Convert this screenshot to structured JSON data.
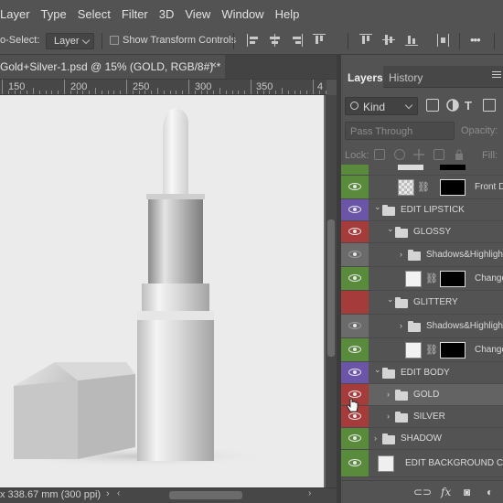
{
  "menubar": {
    "items": [
      "Layer",
      "Type",
      "Select",
      "Filter",
      "3D",
      "View",
      "Window",
      "Help"
    ]
  },
  "options_bar": {
    "auto_select_label": "o-Select:",
    "auto_select_value": "Layer",
    "show_transform_label": "Show Transform Controls",
    "show_transform_checked": false,
    "more_label": "•••"
  },
  "document": {
    "tab_title": "Gold+Silver-1.psd @ 15% (GOLD, RGB/8#) *",
    "close_glyph": "×",
    "ruler_labels": [
      "150",
      "200",
      "250",
      "300",
      "350",
      "4"
    ],
    "status_text": "x 338.67 mm (300 ppi)",
    "status_arrow": "›",
    "scroll_left": "‹",
    "scroll_right": "›"
  },
  "panel": {
    "tabs": [
      "Layers",
      "History"
    ],
    "kind_value": "Kind",
    "blend_mode": "Pass Through",
    "opacity_label": "Opacity:",
    "lock_label": "Lock:",
    "fill_label": "Fill:",
    "layers": [
      {
        "name": "",
        "type": "partial",
        "vis": "green"
      },
      {
        "name": "Front D",
        "type": "layer-mask-dark",
        "vis": "green",
        "indent": 2
      },
      {
        "name": "EDIT LIPSTICK",
        "type": "group",
        "vis": "purple",
        "indent": 0,
        "expanded": true
      },
      {
        "name": "GLOSSY",
        "type": "group",
        "vis": "red",
        "indent": 1,
        "expanded": true
      },
      {
        "name": "Shadows&Highlight",
        "type": "group",
        "vis": "gray",
        "indent": 2,
        "expanded": false
      },
      {
        "name": "Change",
        "type": "adjustment",
        "vis": "green",
        "indent": 2
      },
      {
        "name": "GLITTERY",
        "type": "group",
        "vis": "red-empty",
        "indent": 1,
        "expanded": true
      },
      {
        "name": "Shadows&Highlight",
        "type": "group",
        "vis": "gray",
        "indent": 2,
        "expanded": false
      },
      {
        "name": "Change",
        "type": "adjustment",
        "vis": "green",
        "indent": 2
      },
      {
        "name": "EDIT BODY",
        "type": "group",
        "vis": "purple",
        "indent": 0,
        "expanded": true
      },
      {
        "name": "GOLD",
        "type": "group",
        "vis": "red",
        "indent": 1,
        "expanded": false,
        "selected": true
      },
      {
        "name": "SILVER",
        "type": "group",
        "vis": "red",
        "indent": 1,
        "expanded": false
      },
      {
        "name": "SHADOW",
        "type": "group",
        "vis": "green",
        "indent": 0,
        "expanded": false
      },
      {
        "name": "EDIT BACKGROUND COLO",
        "type": "fill",
        "vis": "green",
        "indent": 0
      }
    ]
  },
  "colors": {
    "app_bg": "#535353",
    "vis_green": "#5a8a3c",
    "vis_purple": "#6a55a8",
    "vis_red": "#a63b3b",
    "vis_gray": "#6b6b6b",
    "canvas_bg": "#ebebeb",
    "selected_row": "#636363"
  }
}
